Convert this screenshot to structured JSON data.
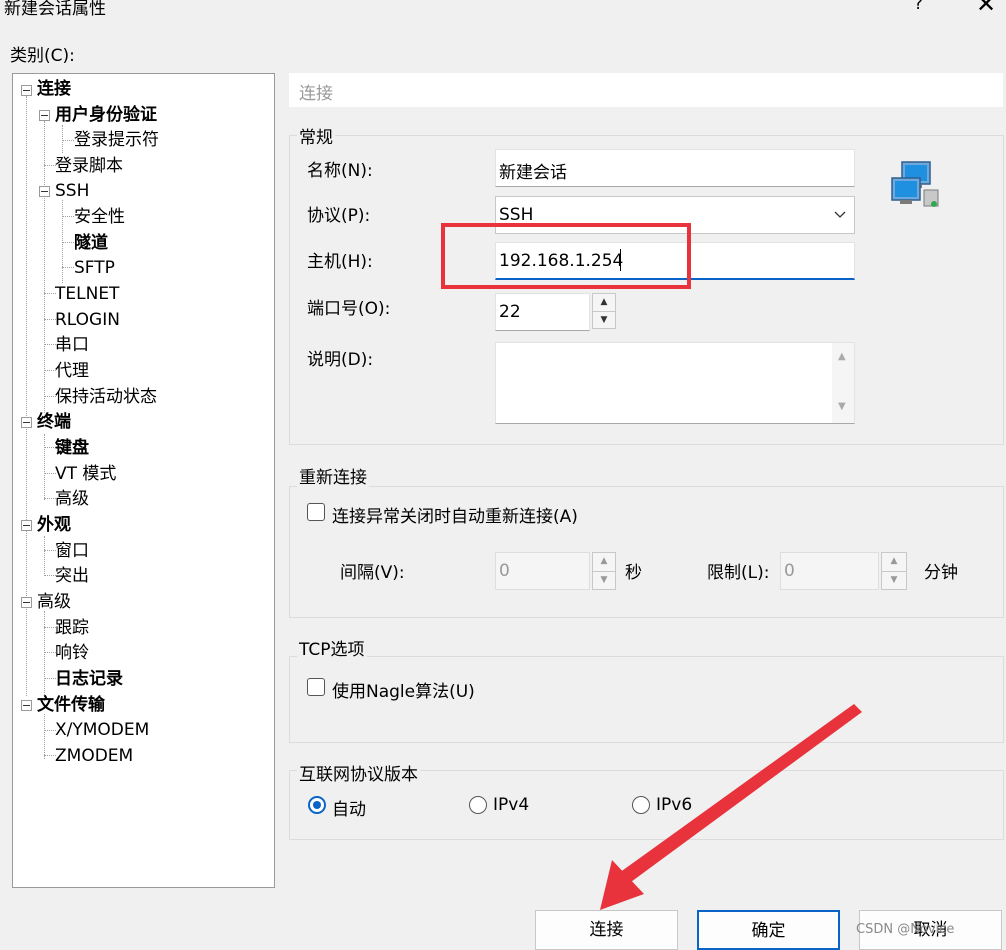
{
  "window": {
    "title": "新建会话属性",
    "help": "?",
    "close": "✕"
  },
  "category_label": "类别(C):",
  "tree": [
    {
      "label": "连接",
      "bold": true
    },
    {
      "label": "用户身份验证",
      "bold": true
    },
    {
      "label": "登录提示符",
      "bold": false
    },
    {
      "label": "登录脚本",
      "bold": false
    },
    {
      "label": "SSH",
      "bold": false
    },
    {
      "label": "安全性",
      "bold": false
    },
    {
      "label": "隧道",
      "bold": true
    },
    {
      "label": "SFTP",
      "bold": false
    },
    {
      "label": "TELNET",
      "bold": false
    },
    {
      "label": "RLOGIN",
      "bold": false
    },
    {
      "label": "串口",
      "bold": false
    },
    {
      "label": "代理",
      "bold": false
    },
    {
      "label": "保持活动状态",
      "bold": false
    },
    {
      "label": "终端",
      "bold": true
    },
    {
      "label": "键盘",
      "bold": true
    },
    {
      "label": "VT 模式",
      "bold": false
    },
    {
      "label": "高级",
      "bold": false
    },
    {
      "label": "外观",
      "bold": true
    },
    {
      "label": "窗口",
      "bold": false
    },
    {
      "label": "突出",
      "bold": false
    },
    {
      "label": "高级",
      "bold": false
    },
    {
      "label": "跟踪",
      "bold": false
    },
    {
      "label": "响铃",
      "bold": false
    },
    {
      "label": "日志记录",
      "bold": true
    },
    {
      "label": "文件传输",
      "bold": true
    },
    {
      "label": "X/YMODEM",
      "bold": false
    },
    {
      "label": "ZMODEM",
      "bold": false
    }
  ],
  "panel": {
    "heading": "连接",
    "general": {
      "legend": "常规",
      "name_label": "名称(N):",
      "name_value": "新建会话",
      "protocol_label": "协议(P):",
      "protocol_value": "SSH",
      "host_label": "主机(H):",
      "host_value": "192.168.1.254",
      "port_label": "端口号(O):",
      "port_value": "22",
      "desc_label": "说明(D):",
      "desc_value": ""
    },
    "reconnect": {
      "legend": "重新连接",
      "checkbox_label": "连接异常关闭时自动重新连接(A)",
      "interval_label": "间隔(V):",
      "interval_value": "0",
      "interval_unit": "秒",
      "limit_label": "限制(L):",
      "limit_value": "0",
      "limit_unit": "分钟"
    },
    "tcp": {
      "legend": "TCP选项",
      "nagle_label": "使用Nagle算法(U)"
    },
    "ip": {
      "legend": "互联网协议版本",
      "auto": "自动",
      "ipv4": "IPv4",
      "ipv6": "IPv6",
      "selected": "自动"
    }
  },
  "buttons": {
    "connect": "连接",
    "ok": "确定",
    "cancel": "取消"
  },
  "watermark": "CSDN @Novice",
  "colors": {
    "accent": "#0a64c8",
    "highlight_box": "#e8323c",
    "arrow": "#e8323c"
  }
}
